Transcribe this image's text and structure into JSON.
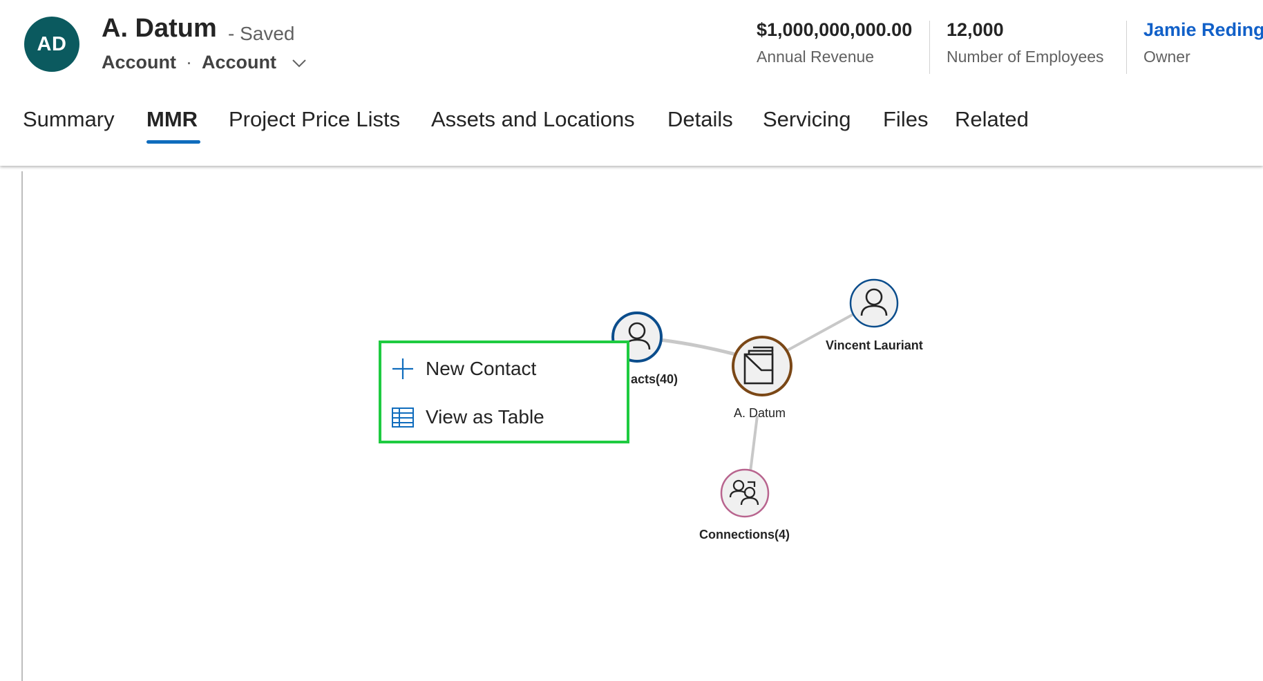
{
  "record": {
    "avatar_initials": "AD",
    "title": "A. Datum",
    "saved_status": "- Saved",
    "entity_type": "Account",
    "separator": "·",
    "form_selector": "Account",
    "form_selector_icon": "chevron-down-icon"
  },
  "kpis": [
    {
      "value": "$1,000,000,000.00",
      "label": "Annual Revenue"
    },
    {
      "value": "12,000",
      "label": "Number of Employees"
    },
    {
      "value": "Jamie Reding",
      "label": "Owner"
    }
  ],
  "tabs": [
    {
      "label": "Summary",
      "active": false
    },
    {
      "label": "MMR",
      "active": true
    },
    {
      "label": "Project Price Lists",
      "active": false
    },
    {
      "label": "Assets and Locations",
      "active": false
    },
    {
      "label": "Details",
      "active": false
    },
    {
      "label": "Servicing",
      "active": false
    },
    {
      "label": "Files",
      "active": false
    },
    {
      "label": "Related",
      "active": false
    }
  ],
  "graph": {
    "center": {
      "label": "A. Datum",
      "icon": "account-folder-icon"
    },
    "nodes": [
      {
        "label": "acts(40)",
        "icon": "person-icon"
      },
      {
        "label": "Vincent Lauriant",
        "icon": "person-icon"
      },
      {
        "label": "Connections(4)",
        "icon": "people-connections-icon"
      }
    ]
  },
  "context_menu": {
    "items": [
      {
        "label": "New Contact",
        "icon": "plus-icon"
      },
      {
        "label": "View as Table",
        "icon": "table-icon"
      }
    ]
  },
  "colors": {
    "avatar_bg": "#0b5a5f",
    "accent": "#0f6cbd",
    "owner_link": "#1160c8",
    "menu_highlight_border": "#1ecb40",
    "contacts_ring": "#0b4d8c",
    "center_ring": "#7a4716",
    "connections_ring": "#b8648e"
  }
}
